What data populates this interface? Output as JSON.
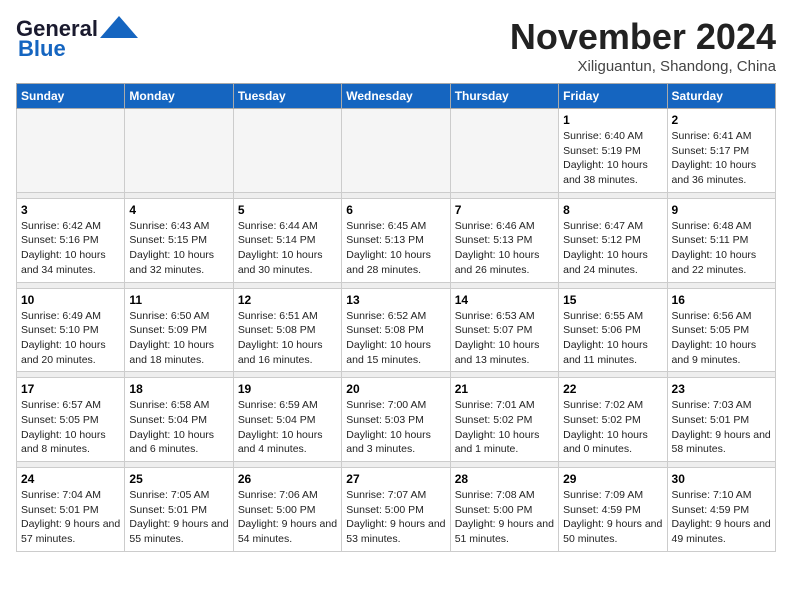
{
  "logo": {
    "line1": "General",
    "line2": "Blue"
  },
  "title": "November 2024",
  "location": "Xiliguantun, Shandong, China",
  "weekdays": [
    "Sunday",
    "Monday",
    "Tuesday",
    "Wednesday",
    "Thursday",
    "Friday",
    "Saturday"
  ],
  "weeks": [
    [
      {
        "day": "",
        "info": ""
      },
      {
        "day": "",
        "info": ""
      },
      {
        "day": "",
        "info": ""
      },
      {
        "day": "",
        "info": ""
      },
      {
        "day": "",
        "info": ""
      },
      {
        "day": "1",
        "info": "Sunrise: 6:40 AM\nSunset: 5:19 PM\nDaylight: 10 hours and 38 minutes."
      },
      {
        "day": "2",
        "info": "Sunrise: 6:41 AM\nSunset: 5:17 PM\nDaylight: 10 hours and 36 minutes."
      }
    ],
    [
      {
        "day": "3",
        "info": "Sunrise: 6:42 AM\nSunset: 5:16 PM\nDaylight: 10 hours and 34 minutes."
      },
      {
        "day": "4",
        "info": "Sunrise: 6:43 AM\nSunset: 5:15 PM\nDaylight: 10 hours and 32 minutes."
      },
      {
        "day": "5",
        "info": "Sunrise: 6:44 AM\nSunset: 5:14 PM\nDaylight: 10 hours and 30 minutes."
      },
      {
        "day": "6",
        "info": "Sunrise: 6:45 AM\nSunset: 5:13 PM\nDaylight: 10 hours and 28 minutes."
      },
      {
        "day": "7",
        "info": "Sunrise: 6:46 AM\nSunset: 5:13 PM\nDaylight: 10 hours and 26 minutes."
      },
      {
        "day": "8",
        "info": "Sunrise: 6:47 AM\nSunset: 5:12 PM\nDaylight: 10 hours and 24 minutes."
      },
      {
        "day": "9",
        "info": "Sunrise: 6:48 AM\nSunset: 5:11 PM\nDaylight: 10 hours and 22 minutes."
      }
    ],
    [
      {
        "day": "10",
        "info": "Sunrise: 6:49 AM\nSunset: 5:10 PM\nDaylight: 10 hours and 20 minutes."
      },
      {
        "day": "11",
        "info": "Sunrise: 6:50 AM\nSunset: 5:09 PM\nDaylight: 10 hours and 18 minutes."
      },
      {
        "day": "12",
        "info": "Sunrise: 6:51 AM\nSunset: 5:08 PM\nDaylight: 10 hours and 16 minutes."
      },
      {
        "day": "13",
        "info": "Sunrise: 6:52 AM\nSunset: 5:08 PM\nDaylight: 10 hours and 15 minutes."
      },
      {
        "day": "14",
        "info": "Sunrise: 6:53 AM\nSunset: 5:07 PM\nDaylight: 10 hours and 13 minutes."
      },
      {
        "day": "15",
        "info": "Sunrise: 6:55 AM\nSunset: 5:06 PM\nDaylight: 10 hours and 11 minutes."
      },
      {
        "day": "16",
        "info": "Sunrise: 6:56 AM\nSunset: 5:05 PM\nDaylight: 10 hours and 9 minutes."
      }
    ],
    [
      {
        "day": "17",
        "info": "Sunrise: 6:57 AM\nSunset: 5:05 PM\nDaylight: 10 hours and 8 minutes."
      },
      {
        "day": "18",
        "info": "Sunrise: 6:58 AM\nSunset: 5:04 PM\nDaylight: 10 hours and 6 minutes."
      },
      {
        "day": "19",
        "info": "Sunrise: 6:59 AM\nSunset: 5:04 PM\nDaylight: 10 hours and 4 minutes."
      },
      {
        "day": "20",
        "info": "Sunrise: 7:00 AM\nSunset: 5:03 PM\nDaylight: 10 hours and 3 minutes."
      },
      {
        "day": "21",
        "info": "Sunrise: 7:01 AM\nSunset: 5:02 PM\nDaylight: 10 hours and 1 minute."
      },
      {
        "day": "22",
        "info": "Sunrise: 7:02 AM\nSunset: 5:02 PM\nDaylight: 10 hours and 0 minutes."
      },
      {
        "day": "23",
        "info": "Sunrise: 7:03 AM\nSunset: 5:01 PM\nDaylight: 9 hours and 58 minutes."
      }
    ],
    [
      {
        "day": "24",
        "info": "Sunrise: 7:04 AM\nSunset: 5:01 PM\nDaylight: 9 hours and 57 minutes."
      },
      {
        "day": "25",
        "info": "Sunrise: 7:05 AM\nSunset: 5:01 PM\nDaylight: 9 hours and 55 minutes."
      },
      {
        "day": "26",
        "info": "Sunrise: 7:06 AM\nSunset: 5:00 PM\nDaylight: 9 hours and 54 minutes."
      },
      {
        "day": "27",
        "info": "Sunrise: 7:07 AM\nSunset: 5:00 PM\nDaylight: 9 hours and 53 minutes."
      },
      {
        "day": "28",
        "info": "Sunrise: 7:08 AM\nSunset: 5:00 PM\nDaylight: 9 hours and 51 minutes."
      },
      {
        "day": "29",
        "info": "Sunrise: 7:09 AM\nSunset: 4:59 PM\nDaylight: 9 hours and 50 minutes."
      },
      {
        "day": "30",
        "info": "Sunrise: 7:10 AM\nSunset: 4:59 PM\nDaylight: 9 hours and 49 minutes."
      }
    ]
  ]
}
